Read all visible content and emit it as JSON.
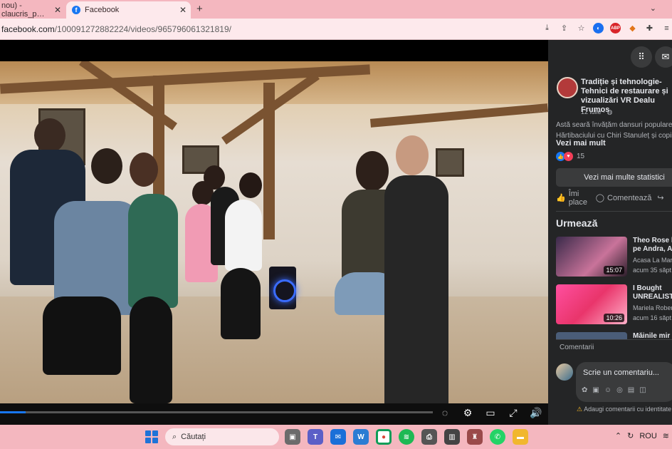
{
  "browser": {
    "tabs": [
      {
        "label": "nou) - claucris_p…",
        "active": false
      },
      {
        "label": "Facebook",
        "active": true
      }
    ],
    "url_host": "facebook.com",
    "url_path": "/100091272882224/videos/965796061321819/",
    "new_tab_glyph": "+",
    "extension_icons": [
      "download-icon",
      "share-icon",
      "bookmark-star-icon",
      "extension-blue-icon",
      "adblock-icon",
      "metamask-icon",
      "puzzle-icon",
      "playlist-icon"
    ],
    "adblock_label": "ABP"
  },
  "post": {
    "page_name": "Tradiție și tehnologie- Tehnici de restaurare și vizualizări VR Dealu Frumos",
    "date": "12 iulie ·",
    "text": "Astă seară învățăm dansuri populare Hărtibaciului cu Chiri Stanuleț și copii",
    "see_more": "Vezi mai mult",
    "reaction_count": "15",
    "stats_button": "Vezi mai multe statistici",
    "like_label": "Îmi place",
    "comment_label": "Comentează"
  },
  "up_next": {
    "heading": "Urmează",
    "videos": [
      {
        "title": "Theo Rose l pe Andra, A",
        "channel": "Acasa La Maruț",
        "age": "acum 35 săpt",
        "duration": "15:07"
      },
      {
        "title": "I Bought UNREALIST",
        "channel": "Mariela Robert",
        "age": "acum 16 săpt",
        "duration": "10:26"
      },
      {
        "title": "Măinile mir",
        "channel": "",
        "age": "",
        "duration": ""
      }
    ]
  },
  "comments": {
    "label": "Comentarii",
    "placeholder": "Scrie un comentariu...",
    "warning": "Adaugi comentarii cu identitate"
  },
  "video": {
    "progress_fraction": 0.06
  },
  "taskbar": {
    "search_label": "Căutați",
    "language": "ROU"
  },
  "colors": {
    "chrome_pink": "#f4b7bf",
    "fb_blue": "#1877f2",
    "sidebar_bg": "#242526"
  }
}
